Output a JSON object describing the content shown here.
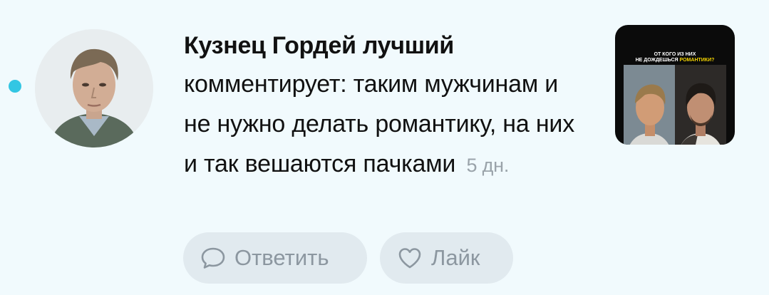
{
  "notification": {
    "author": "Кузнец Гордей лучший",
    "comment_text": "комментирует: таким мужчинам и не нужно делать романтику, на них и так вешаются пачками",
    "time_ago": "5 дн.",
    "unread": true,
    "avatar_icon": "user-avatar-photo"
  },
  "post_thumbnail": {
    "caption_line1": "ОТ КОГО ИЗ НИХ",
    "caption_line2_prefix": "НЕ ДОЖДЕШЬСЯ",
    "caption_line2_accent": "РОМАНТИКИ?"
  },
  "actions": {
    "reply_label": "Ответить",
    "reply_icon": "speech-bubble-icon",
    "like_label": "Лайк",
    "like_icon": "heart-icon"
  },
  "colors": {
    "background": "#f1fafd",
    "unread_dot": "#33c6e3",
    "button_bg": "#e1eaef",
    "button_text": "#8c97a0",
    "time_text": "#9aa3aa",
    "thumb_accent": "#f5d400"
  }
}
